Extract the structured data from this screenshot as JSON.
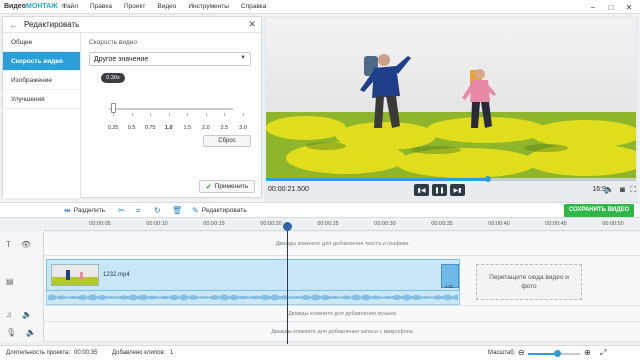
{
  "app": {
    "logo_prefix": "Видео",
    "logo_accent": "МОНТАЖ",
    "menu": [
      "Файл",
      "Правка",
      "Проект",
      "Видео",
      "Инструменты",
      "Справка"
    ]
  },
  "window_controls": {
    "minimize": "−",
    "maximize": "□",
    "close": "✕"
  },
  "edit_panel": {
    "title": "Редактировать",
    "nav": [
      {
        "label": "Общее",
        "active": false
      },
      {
        "label": "Скорость видео",
        "active": true
      },
      {
        "label": "Изображение",
        "active": false
      },
      {
        "label": "Улучшения",
        "active": false
      }
    ],
    "speed_label": "Скорость видео",
    "speed_select_value": "Другое значение",
    "speed_tooltip": "0.30x",
    "speed_value": 0.3,
    "slider_ticks": [
      "0.25",
      "0.5",
      "0.75",
      "1.0",
      "1.5",
      "2.0",
      "2.5",
      "3.0"
    ],
    "slider_bold_tick": "1.0",
    "reset_label": "Сброс",
    "apply_label": "Применить"
  },
  "player": {
    "timecode": "00:00:21.500",
    "aspect": "16:9",
    "progress": 0.6
  },
  "toolbar": {
    "split_label": "Разделить",
    "edit_label": "Редактировать",
    "save_label": "СОХРАНИТЬ ВИДЕО"
  },
  "ruler": {
    "labels": [
      "00:00:05",
      "00:00:10",
      "00:00:15",
      "00:00:20",
      "00:00:25",
      "00:00:30",
      "00:00:35",
      "00:00:40",
      "00:00:45",
      "00:00:50"
    ]
  },
  "tracks": {
    "text_hint": "Дважды кликните для добавления текста и графики",
    "music_hint": "Дважды кликните для добавления музыки",
    "mic_hint": "Дважды кликните для добавления записи с микрофона",
    "clip_name": "1232.mp4",
    "clip_end_label": "1.0с",
    "drop_zone": "Перетащите сюда видео и фото"
  },
  "status": {
    "duration_label": "Длительность проекта:",
    "duration_value": "00:00:35",
    "clips_label": "Добавлено клипов:",
    "clips_value": "1",
    "zoom_label": "Масштаб:",
    "zoom_level": 0.55
  },
  "colors": {
    "accent": "#2a9fd8",
    "save_green": "#2eb847",
    "dark_button": "#2e3a46"
  }
}
